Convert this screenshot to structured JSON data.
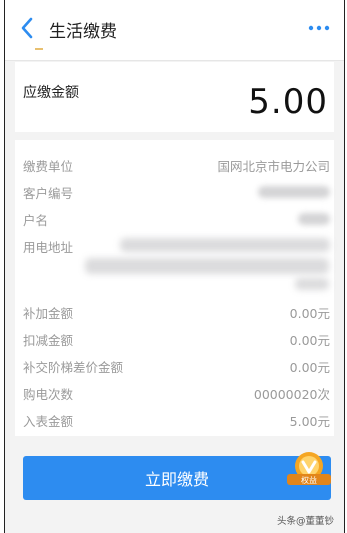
{
  "header": {
    "title": "生活缴费",
    "back_icon": "chevron-left-icon",
    "more_icon": "more-dots-icon"
  },
  "amount": {
    "label": "应缴金额",
    "value": "5.00"
  },
  "details": {
    "unit_label": "缴费单位",
    "unit_value": "国网北京市电力公司",
    "customer_no_label": "客户编号",
    "name_label": "户名",
    "address_label": "用电地址",
    "surcharge_label": "补加金额",
    "surcharge_value": "0.00元",
    "deduction_label": "扣减金额",
    "deduction_value": "0.00元",
    "tier_diff_label": "补交阶梯差价金额",
    "tier_diff_value": "0.00元",
    "purchase_count_label": "购电次数",
    "purchase_count_value": "00000020次",
    "meter_amount_label": "入表金额",
    "meter_amount_value": "5.00元"
  },
  "actions": {
    "pay_label": "立即缴费",
    "badge_text": "权益"
  },
  "watermark": "头条@董董钞",
  "colors": {
    "accent": "#2d8cf0",
    "badge": "#f5a623",
    "muted_text": "#9a9a9a"
  }
}
